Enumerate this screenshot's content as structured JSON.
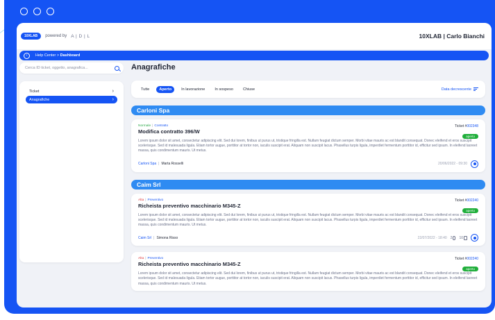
{
  "window": {
    "controls": [
      "close",
      "minimize",
      "maximize"
    ]
  },
  "header": {
    "logo_text": "10XLAB",
    "powered_by": "powered by",
    "partner_logo": "A | D | L",
    "user_title": "10XLAB | Carlo Bianchi"
  },
  "breadcrumb": {
    "home": "Help Center",
    "separator": ">",
    "current": "Dashboard"
  },
  "search": {
    "placeholder": "Cerca ID ticket, oggetto, anagrafica..."
  },
  "sidebar": {
    "items": [
      {
        "label": "Ticket",
        "active": false
      },
      {
        "label": "Anagrafiche",
        "active": true
      }
    ]
  },
  "main": {
    "title": "Anagrafiche",
    "filters": [
      {
        "label": "Tutte",
        "active": false
      },
      {
        "label": "Aperto",
        "active": true
      },
      {
        "label": "In lavorazione",
        "active": false
      },
      {
        "label": "In sospeso",
        "active": false
      },
      {
        "label": "Chiuse",
        "active": false
      }
    ],
    "sort_label": "Data decrescente"
  },
  "groups": [
    {
      "name": "Carloni Spa",
      "tickets": [
        {
          "priority": "Normale",
          "priority_color": "#2ca84a",
          "type": "Contratto",
          "title": "Modifica contratto 396/W",
          "ticket_prefix": "Ticket #",
          "ticket_number": "002348",
          "status": "aperto",
          "body": "Lorem ipsum dolor sit amet, consectetur adipiscing elit. Sed dui lorem, finibus ut purus ut, tristique fringilla est. Nullam feugiat dictum semper. Morbi vitae mauris ac est blandit consequat. Donec eleifend et eros suscipit scelerisque. Sed id malesuada ligula. Etiam tortor augue, porttitor at tortor non, iaculis suscipit erat. Aliquam non suscipit lacus. Phasellus turpis ligula, imperdiet fermentum porttitor id, efficitur sed ipsum. In eleifend laoreet massa, quis condimentum mauris. Ut metus.",
          "company": "Carloni Spa",
          "person": "Marta Rosselli",
          "date": "20/06/2022 - 09:30"
        }
      ]
    },
    {
      "name": "Caim Srl",
      "tickets": [
        {
          "priority": "Alta",
          "priority_color": "#e03c3c",
          "type": "Preventivo",
          "title": "Richeista preventivo macchinario M345-Z",
          "ticket_prefix": "Ticket #",
          "ticket_number": "002240",
          "status": "aperto",
          "body": "Lorem ipsum dolor sit amet, consectetur adipiscing elit. Sed dui lorem, finibus ut purus ut, tristique fringilla est. Nullam feugiat dictum semper. Morbi vitae mauris ac est blandit consequat. Donec eleifend et eros suscipit scelerisque. Sed id malesuada ligula. Etiam tortor augue, porttitor at tortor non, iaculis suscipit erat. Aliquam non suscipit lacus. Phasellus turpis ligula, imperdiet fermentum porttitor id, efficitur sed ipsum. In eleifend laoreet massa, quis condimentum mauris. Ut metus.",
          "company": "Caim Srl",
          "person": "Simona Risso",
          "date": "22/07/2022 - 18:40",
          "attachments": "2",
          "documents": "10"
        },
        {
          "priority": "Alta",
          "priority_color": "#e03c3c",
          "type": "Preventivo",
          "title": "Richeista preventivo macchinario M345-Z",
          "ticket_prefix": "Ticket #",
          "ticket_number": "002240",
          "status": "aperto",
          "body": "Lorem ipsum dolor sit amet, consectetur adipiscing elit. Sed dui lorem, finibus ut purus ut, tristique fringilla est. Nullam feugiat dictum semper. Morbi vitae mauris ac est blandit consequat. Donec eleifend et eros suscipit scelerisque. Sed id malesuada ligula. Etiam tortor augue, porttitor at tortor non, iaculis suscipit erat. Aliquam non suscipit lacus. Phasellus turpis ligula, imperdiet fermentum porttitor id, efficitur sed ipsum. In eleifend laoreet massa, quis condimentum mauris. Ut metus."
        }
      ]
    }
  ],
  "colors": {
    "primary": "#1554f4",
    "group_header": "#2f8bf2",
    "status_open": "#1fae3a",
    "background": "#f0f2f7"
  }
}
